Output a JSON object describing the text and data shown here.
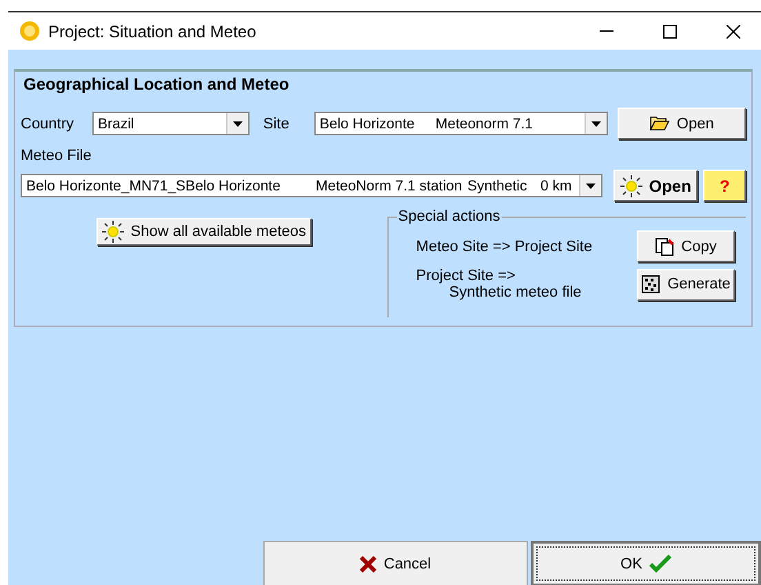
{
  "window": {
    "title": "Project: Situation and Meteo"
  },
  "group": {
    "title": "Geographical Location and Meteo"
  },
  "country": {
    "label": "Country",
    "value": "Brazil"
  },
  "site": {
    "label": "Site",
    "columns": [
      "Belo Horizonte",
      "Meteonorm 7.1"
    ]
  },
  "open_site_button": "Open",
  "meteo_file": {
    "label": "Meteo File",
    "columns": [
      "Belo Horizonte_MN71_SBelo Horizonte",
      "MeteoNorm 7.1 station",
      "Synthetic",
      "0 km"
    ]
  },
  "open_meteo_button": "Open",
  "help_button": "?",
  "show_meteos_button": "Show all available meteos",
  "special_actions": {
    "title": "Special actions",
    "rows": [
      {
        "text": "Meteo Site => Project Site",
        "button": "Copy",
        "kind": "copy"
      },
      {
        "text": "Project Site =>",
        "text2": "Synthetic meteo file",
        "button": "Generate",
        "kind": "generate"
      }
    ]
  },
  "footer": {
    "cancel": "Cancel",
    "ok": "OK"
  }
}
